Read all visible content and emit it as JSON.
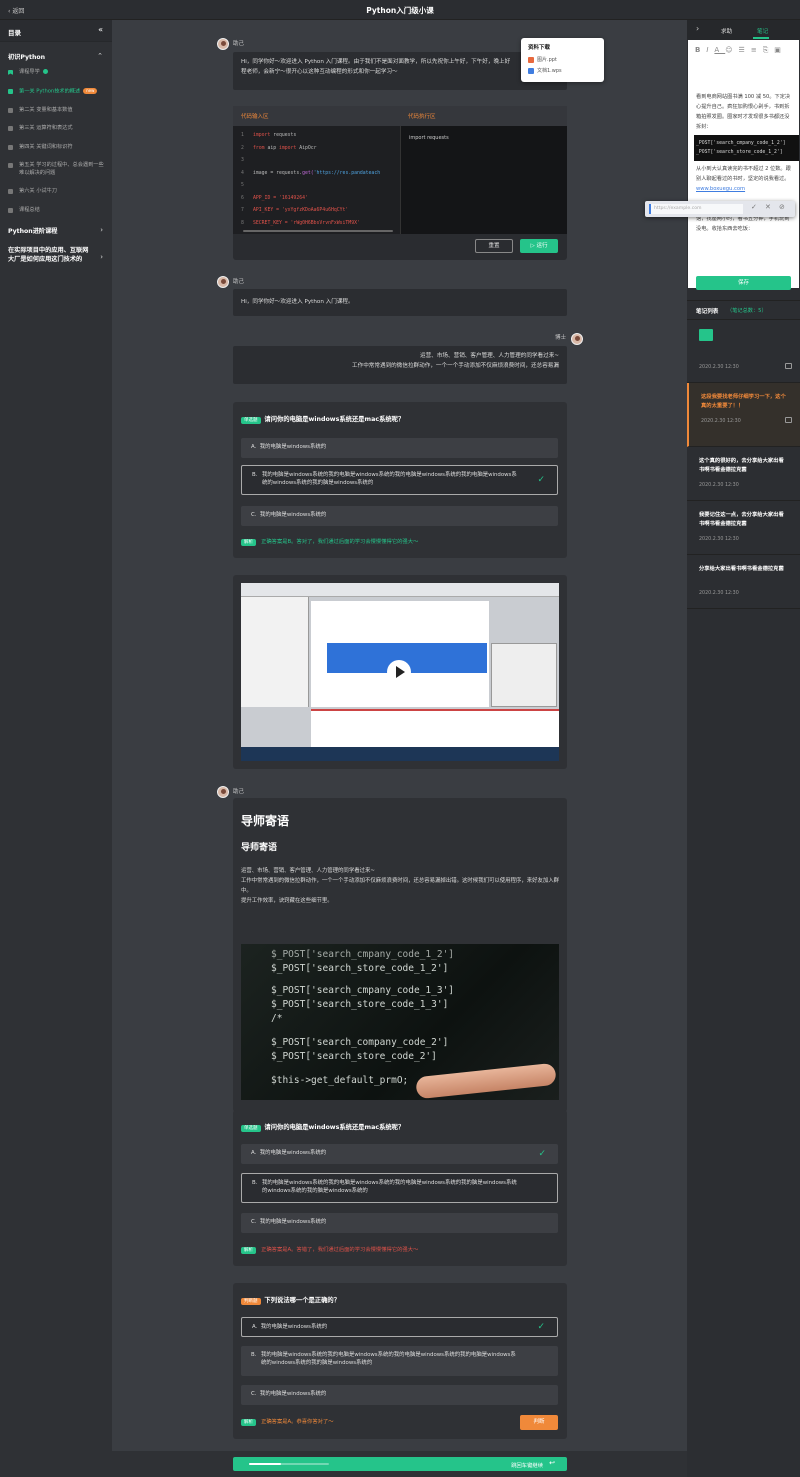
{
  "app": {
    "back": "返回",
    "title": "Python入门级小课"
  },
  "sidebar": {
    "title": "目录",
    "section1": "初识Python",
    "items": [
      {
        "label": "课程导学",
        "state": "done"
      },
      {
        "label": "第一关 Python技术的概述",
        "state": "active",
        "badge": "new"
      },
      {
        "label": "第二关 变量和基本数值",
        "state": "lock"
      },
      {
        "label": "第三关 运算符和表达式",
        "state": "lock"
      },
      {
        "label": "第四关 关键词和标识符",
        "state": "lock"
      },
      {
        "label": "第五关 学习的过程中、总会遇到一些难以解决的问题",
        "state": "lock"
      },
      {
        "label": "第六关 小试牛刀",
        "state": "lock"
      },
      {
        "label": "课程总结",
        "state": "lock"
      }
    ],
    "section2": "Python进阶课程",
    "section3": "在实际项目中的应用、互联网大厂是如何应用这门技术的"
  },
  "chat": {
    "teacher": "助己",
    "student": "博士",
    "msg1": "Hi，同学你好～欢迎进入 Python 入门课程。由于我们不是面对面教学，所以先祝你上午好，下午好，晚上好",
    "msg1b": "程老师，会新宁～很开心以这种互动编程的形式和你一起学习～",
    "msg2": "Hi，同学你好～欢迎进入 Python 入门课程。",
    "msg3a": "运营、市场、营销、客户管理、人力管理的同学看过来~",
    "msg3b": "工作中常常遇到的微信拉群动作，一个一个手动添加不仅麻烦浪费时间，还总容易漏"
  },
  "downloads": {
    "title": "资料下载",
    "files": [
      "图片.ppt",
      "文档1.wps"
    ]
  },
  "code": {
    "input_label": "代码输入区",
    "output_label": "代码执行区",
    "output_text": "import requests",
    "lines": [
      {
        "n": "1",
        "parts": [
          {
            "t": "import",
            "c": "#e0524a"
          },
          {
            "t": " requests",
            "c": "#bbb"
          }
        ]
      },
      {
        "n": "2",
        "parts": [
          {
            "t": "from",
            "c": "#e0524a"
          },
          {
            "t": " aip ",
            "c": "#bbb"
          },
          {
            "t": "import",
            "c": "#e0524a"
          },
          {
            "t": " AipOcr",
            "c": "#bbb"
          }
        ]
      },
      {
        "n": "3",
        "parts": []
      },
      {
        "n": "4",
        "parts": [
          {
            "t": "image = requests.",
            "c": "#bbb"
          },
          {
            "t": "get(",
            "c": "#c06ad8"
          },
          {
            "t": "'https://res.pandateach",
            "c": "#4fa3e0"
          }
        ]
      },
      {
        "n": "5",
        "parts": []
      },
      {
        "n": "6",
        "parts": [
          {
            "t": "APP_ID = '16149264'",
            "c": "#e0524a"
          }
        ]
      },
      {
        "n": "7",
        "parts": [
          {
            "t": "API_KEY = 'yxYgfzKDoAa6P4u6HqCYt'",
            "c": "#e0524a"
          }
        ]
      },
      {
        "n": "8",
        "parts": [
          {
            "t": "SECRET_KEY = 'rWg0H6BbsVrvnFxWsiTM9X'",
            "c": "#e0524a"
          }
        ]
      }
    ],
    "reset": "重置",
    "run": "▷ 运行"
  },
  "quiz1": {
    "tag": "单选题",
    "question": "请问你的电脑是windows系统还是mac系统呢？",
    "options": [
      {
        "letter": "A.",
        "text": "我的电脑是windows系统的"
      },
      {
        "letter": "B.",
        "text": "我的电脑是windows系统的我的电脑是windows系统的我的电脑是windows系统的我的电脑是windows系统的windows系统的我的脑是windows系统的"
      },
      {
        "letter": "C.",
        "text": "我的电脑是windows系统的"
      }
    ],
    "expl_tag": "解析",
    "explanation": "正确答案是B。答对了，我们通过后面的学习会慢慢懂得它的强大～"
  },
  "article": {
    "title": "导师寄语",
    "subtitle": "导师寄语",
    "p1": "运营、市场、营销、客户管理、人力管理的同学看过来~",
    "p2": "工作中常常遇到的微信拉群动作，一个一个手动添加不仅麻烦浪费时间，还总容易漏掉出错。这时候我们可以使用程序，来好友加入群中。",
    "p3": "提升工作效率，诀窍藏在这些细节里。",
    "img_lines": [
      "$_POST['search_cmpany_code_1_2']",
      "$_POST['search_store_code_1_2']",
      "$_POST['search_cmpany_code_1_3']",
      "$_POST['search_store_code_1_3']",
      "/*",
      "$_POST['search_company_code_2']",
      "$_POST['search_store_code_2']",
      "$this->get_default_prmO;"
    ]
  },
  "quiz2": {
    "tag": "单选题",
    "question": "请问你的电脑是windows系统还是mac系统呢？",
    "options": [
      {
        "letter": "A.",
        "text": "我的电脑是windows系统的"
      },
      {
        "letter": "B.",
        "text": "我的电脑是windows系统的我的电脑是windows系统的我的电脑是windows系统的我的脑是windows系统的windows系统的我的脑是windows系统的"
      },
      {
        "letter": "C.",
        "text": "我的电脑是windows系统的"
      }
    ],
    "expl_tag": "解析",
    "explanation": "正确答案是A。答错了，我们通过后面的学习会慢慢懂得它的强大～"
  },
  "quiz3": {
    "tag": "判断题",
    "question": "下列说法哪一个是正确的？",
    "options": [
      {
        "letter": "A.",
        "text": "我的电脑是windows系统的"
      },
      {
        "letter": "B.",
        "text": "我的电脑是windows系统的我的电脑是windows系统的我的电脑是windows系统的我的电脑是windows系统的windows系统的我的脑是windows系统的"
      },
      {
        "letter": "C.",
        "text": "我的电脑是windows系统的"
      }
    ],
    "expl_tag": "解析",
    "explanation": "正确答案是A。恭喜你答对了～",
    "judge": "判断"
  },
  "bottom": {
    "return": "跳回车键继续",
    "progress": 0.4
  },
  "right": {
    "tab1": "求助",
    "tab2": "笔记",
    "editor_text1": "看到电商网站图书满 100 减 50。下定决心提升自己。疯狂加购恨心剁手，书到拆箱拍照发圈。圈家时才发现很多书都还没拆封：",
    "editor_code": [
      "_POST['search_cmpany_code_1_2']",
      "_POST['search_store_code_1_2']"
    ],
    "editor_text2": "从小到大认真读完的书不超过 2 位数。跟别人聊起看过的书时，坚定的说我看过。",
    "editor_link": "www.boxuegu.com",
    "editor_text3": "跟男朋友/女朋友/室友约好了一起去图书馆，找座两小时，看书五分钟，手机玩到没电。收拾东西去吃饭：",
    "link_placeholder": "https://example.com",
    "save": "保存",
    "notes_title": "笔记列表",
    "notes_count_label": "笔记总数：5",
    "notes": [
      {
        "text": "",
        "date": "2020.2.30 12:30",
        "type": "image"
      },
      {
        "text": "这段我要找老师仔细学习一下，这个真的太重要了！！",
        "date": "2020.2.30 12:30",
        "type": "highlight"
      },
      {
        "text": "这个真的很好的，去分享给大家出看书啊书看金德拉克菌",
        "date": "2020.2.30 12:30",
        "type": "plain"
      },
      {
        "text": "我要记住这一点，去分享给大家出看书啊书看金德拉克菌",
        "date": "2020.2.30 12:30",
        "type": "plain"
      },
      {
        "text": "分享给大家出看书啊书看金德拉克菌",
        "date": "2020.2.30 12:30",
        "type": "plain"
      }
    ]
  }
}
